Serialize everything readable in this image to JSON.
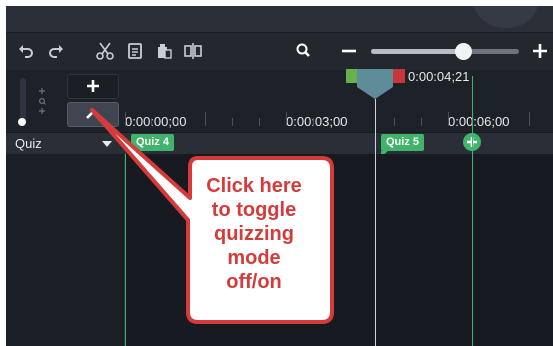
{
  "timeline": {
    "playhead_time": "0:00:04;21",
    "ruler_labels": [
      "0:00:00;00",
      "0:00:03;00",
      "0:00:06;00"
    ],
    "add_track_symbol": "+",
    "quiz_toggle_symbol": "^"
  },
  "quiz_track": {
    "label": "Quiz",
    "markers": [
      "Quiz 4",
      "Quiz 5"
    ]
  },
  "toolbar": {
    "icons": [
      "undo-icon",
      "redo-icon",
      "cut-icon",
      "copy-icon",
      "paste-icon",
      "split-icon",
      "zoom-search-icon",
      "zoom-out-icon",
      "zoom-slider",
      "zoom-in-icon"
    ]
  },
  "annotation": {
    "lines": [
      "Click here",
      "to toggle",
      "quizzing",
      "mode",
      "off/on"
    ]
  },
  "colors": {
    "quiz_green": "#3fb46a",
    "callout_red": "#d63b3b",
    "playhead_teal": "#5f8c99",
    "timeline_bg": "#171b21"
  }
}
